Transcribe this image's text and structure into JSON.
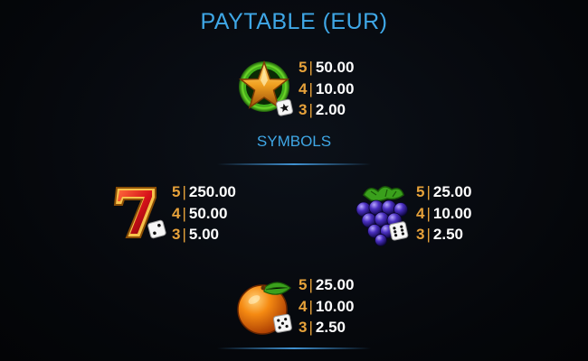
{
  "title": "PAYTABLE  (EUR)",
  "section_label": "SYMBOLS",
  "symbols": [
    {
      "icon": "star-scatter-icon",
      "pays": [
        {
          "count": "5",
          "value": "50.00"
        },
        {
          "count": "4",
          "value": "10.00"
        },
        {
          "count": "3",
          "value": "2.00"
        }
      ]
    },
    {
      "icon": "seven-icon",
      "pays": [
        {
          "count": "5",
          "value": "250.00"
        },
        {
          "count": "4",
          "value": "50.00"
        },
        {
          "count": "3",
          "value": "5.00"
        }
      ]
    },
    {
      "icon": "grapes-icon",
      "pays": [
        {
          "count": "5",
          "value": "25.00"
        },
        {
          "count": "4",
          "value": "10.00"
        },
        {
          "count": "3",
          "value": "2.50"
        }
      ]
    },
    {
      "icon": "orange-icon",
      "pays": [
        {
          "count": "5",
          "value": "25.00"
        },
        {
          "count": "4",
          "value": "10.00"
        },
        {
          "count": "3",
          "value": "2.50"
        }
      ]
    }
  ],
  "colors": {
    "heading": "#3fa7e6",
    "count": "#e7a23a",
    "value": "#ffffff",
    "background": "#06080d"
  }
}
